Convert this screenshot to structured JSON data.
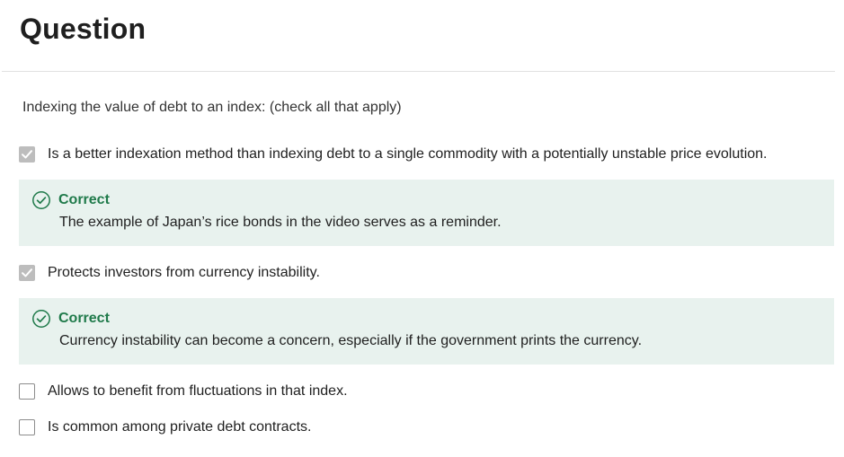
{
  "header": {
    "title": "Question"
  },
  "question": {
    "prompt": "Indexing the value of debt to an index: (check all that apply)"
  },
  "options": [
    {
      "label": "Is a better indexation method than indexing debt to a single commodity with a potentially unstable price evolution.",
      "checked": true
    },
    {
      "label": "Protects investors from currency instability.",
      "checked": true
    },
    {
      "label": "Allows to benefit from fluctuations in that index.",
      "checked": false
    },
    {
      "label": "Is common among private debt contracts.",
      "checked": false
    }
  ],
  "feedback": [
    {
      "status": "Correct",
      "explanation": "The example of Japan’s rice bonds in the video serves as a reminder."
    },
    {
      "status": "Correct",
      "explanation": "Currency instability can become a concern, especially if the government prints the currency."
    }
  ],
  "colors": {
    "correct_green": "#1f7a4a",
    "feedback_background": "#e8f2ee",
    "checked_gray": "#bdbdbd"
  },
  "icons": {
    "checkbox_checked": "check-icon",
    "correct": "check-circle-icon"
  }
}
